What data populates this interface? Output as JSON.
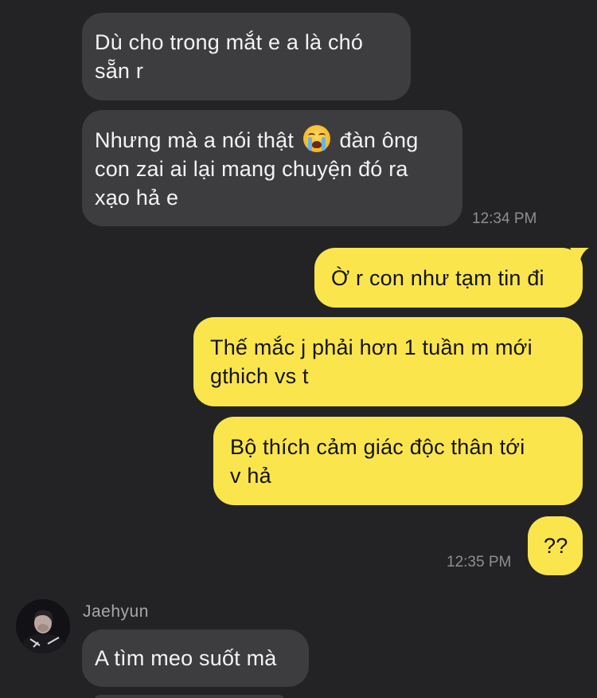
{
  "messages": [
    {
      "direction": "in",
      "text_lines": [
        "Dù cho trong mắt e a là chó",
        "sẵn r"
      ]
    },
    {
      "direction": "in",
      "text_before_emoji": "Nhưng mà a nói thật",
      "emoji": "loudly-crying-face",
      "text_after_emoji": "đàn ông",
      "text_lines_rest": [
        "con zai ai lại mang chuyện đó ra",
        "xạo hả e"
      ],
      "time": "12:34 PM"
    },
    {
      "direction": "out",
      "text_lines": [
        "Ờ r con như tạm tin đi"
      ]
    },
    {
      "direction": "out",
      "text_lines": [
        "Thế mắc j phải hơn 1 tuần m mới",
        "gthich vs t"
      ]
    },
    {
      "direction": "out",
      "text_lines": [
        "Bộ thích cảm giác độc thân tới",
        "v hả"
      ]
    },
    {
      "direction": "out",
      "text_lines": [
        "??"
      ],
      "time": "12:35 PM"
    },
    {
      "direction": "in",
      "sender": "Jaehyun",
      "avatar": "profile-photo",
      "text_lines": [
        "A tìm meo suốt mà"
      ]
    }
  ],
  "colors": {
    "background": "#232325",
    "incoming_bubble": "#3d3d40",
    "outgoing_bubble": "#fae54d",
    "timestamp": "#8e8e92"
  }
}
